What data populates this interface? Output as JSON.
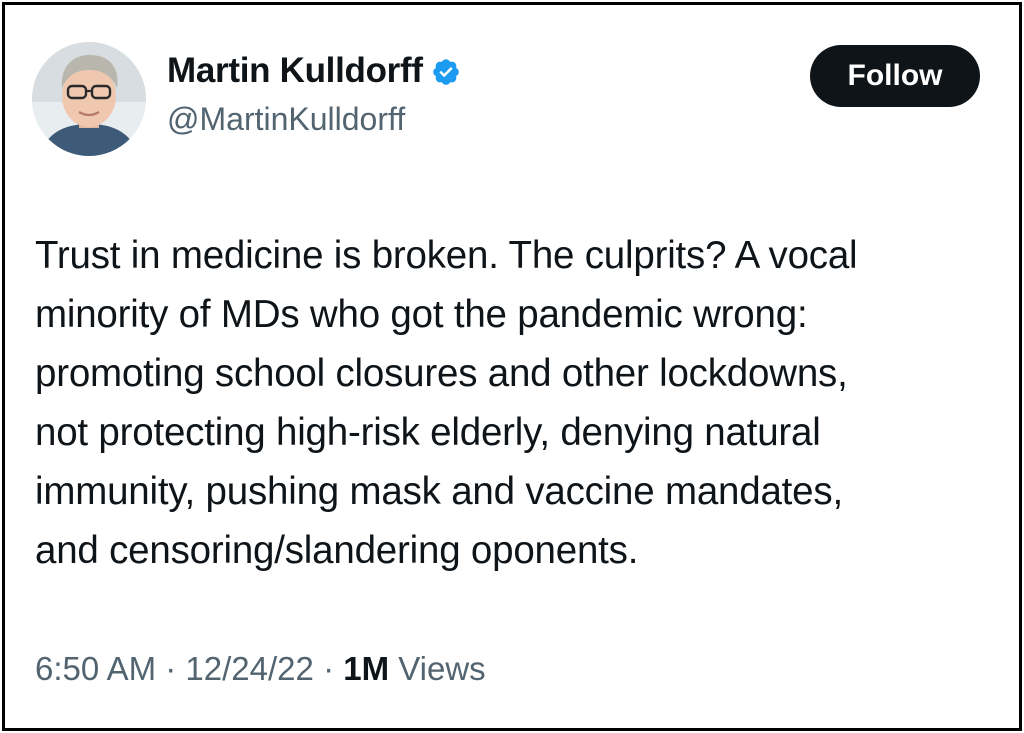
{
  "author": {
    "name": "Martin Kulldorff",
    "handle": "@MartinKulldorff",
    "verified_icon": "verified-badge-icon",
    "badge_color": "#1d9bf0"
  },
  "follow_button": {
    "label": "Follow"
  },
  "tweet": {
    "lines": [
      "Trust in medicine is broken. The culprits? A vocal",
      "minority of MDs who got the pandemic wrong:",
      "promoting school closures and other lockdowns,",
      "not protecting high-risk elderly, denying natural",
      "immunity, pushing mask and vaccine mandates,",
      "and censoring/slandering oponents."
    ]
  },
  "meta": {
    "time": "6:50 AM",
    "separator": "·",
    "date": "12/24/22",
    "views_count": "1M",
    "views_label": "Views"
  }
}
